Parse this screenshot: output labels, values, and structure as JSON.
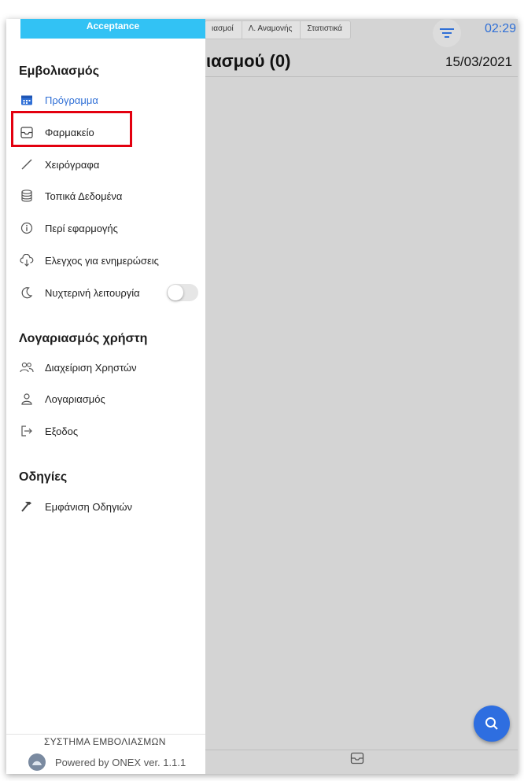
{
  "background": {
    "tabs": [
      "ιασμοί",
      "Λ. Αναμονής",
      "Στατιστικά"
    ],
    "time": "02:29",
    "title": "ιασμού (0)",
    "date": "15/03/2021"
  },
  "drawer": {
    "environment": "Acceptance",
    "sections": [
      {
        "title": "Εμβολιασμός",
        "items": [
          {
            "label": "Πρόγραμμα",
            "icon": "calendar-icon",
            "active": true
          },
          {
            "label": "Φαρμακείο",
            "icon": "inbox-icon",
            "active": false,
            "highlighted": true
          },
          {
            "label": "Χειρόγραφα",
            "icon": "pen-icon"
          },
          {
            "label": "Τοπικά Δεδομένα",
            "icon": "database-icon"
          },
          {
            "label": "Περί εφαρμογής",
            "icon": "info-icon"
          },
          {
            "label": "Ελεγχος για ενημερώσεις",
            "icon": "cloud-download-icon"
          },
          {
            "label": "Νυχτερινή λειτουργία",
            "icon": "moon-icon",
            "toggle": false
          }
        ]
      },
      {
        "title": "Λογαριασμός χρήστη",
        "items": [
          {
            "label": "Διαχείριση Χρηστών",
            "icon": "users-icon"
          },
          {
            "label": "Λογαριασμός",
            "icon": "user-icon"
          },
          {
            "label": "Εξοδος",
            "icon": "logout-icon"
          }
        ]
      },
      {
        "title": "Οδηγίες",
        "items": [
          {
            "label": "Εμφάνιση Οδηγιών",
            "icon": "hammer-icon"
          }
        ]
      }
    ],
    "footer": {
      "system": "ΣΥΣΤΗΜΑ ΕΜΒΟΛΙΑΣΜΩΝ",
      "powered": "Powered by ONEX ver. 1.1.1"
    }
  },
  "colors": {
    "accent": "#2f6fd6",
    "env_bar": "#32c2f4",
    "highlight": "#e3000f",
    "overlay": "#d4d4d4"
  }
}
